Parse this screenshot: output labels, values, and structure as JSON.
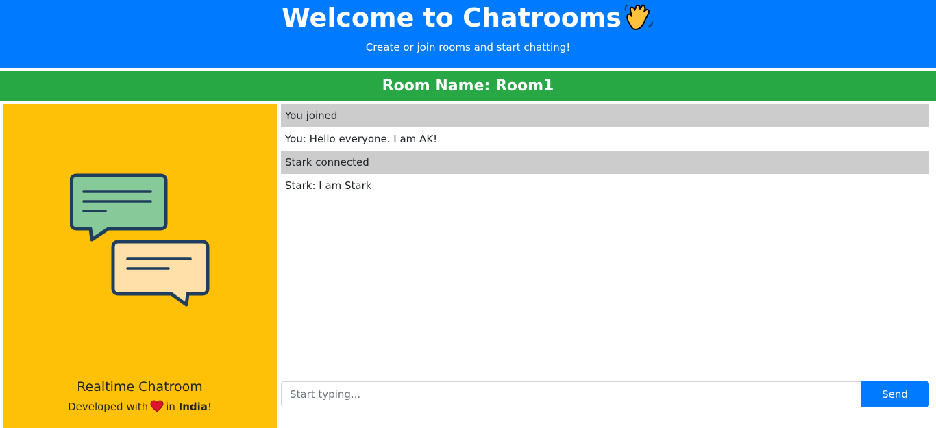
{
  "header": {
    "title": "Welcome to Chatrooms",
    "subtitle": "Create or join rooms and start chatting!"
  },
  "room": {
    "label": "Room Name: Room1"
  },
  "sidebar": {
    "title": "Realtime Chatroom",
    "credit_prefix": "Developed with",
    "credit_middle": "in",
    "credit_country": "India",
    "credit_suffix": "!"
  },
  "messages": [
    {
      "type": "system",
      "text": "You joined"
    },
    {
      "type": "user",
      "text": "You: Hello everyone. I am AK!"
    },
    {
      "type": "system",
      "text": "Stark connected"
    },
    {
      "type": "user",
      "text": "Stark: I am Stark"
    }
  ],
  "composer": {
    "placeholder": "Start typing...",
    "send_label": "Send"
  },
  "colors": {
    "header_bg": "#007bff",
    "room_bar_bg": "#28a745",
    "sidebar_bg": "#ffc107",
    "system_message_bg": "#cccccc"
  },
  "icons": [
    "waving-hand-icon",
    "chat-bubbles-icon",
    "heart-icon"
  ]
}
